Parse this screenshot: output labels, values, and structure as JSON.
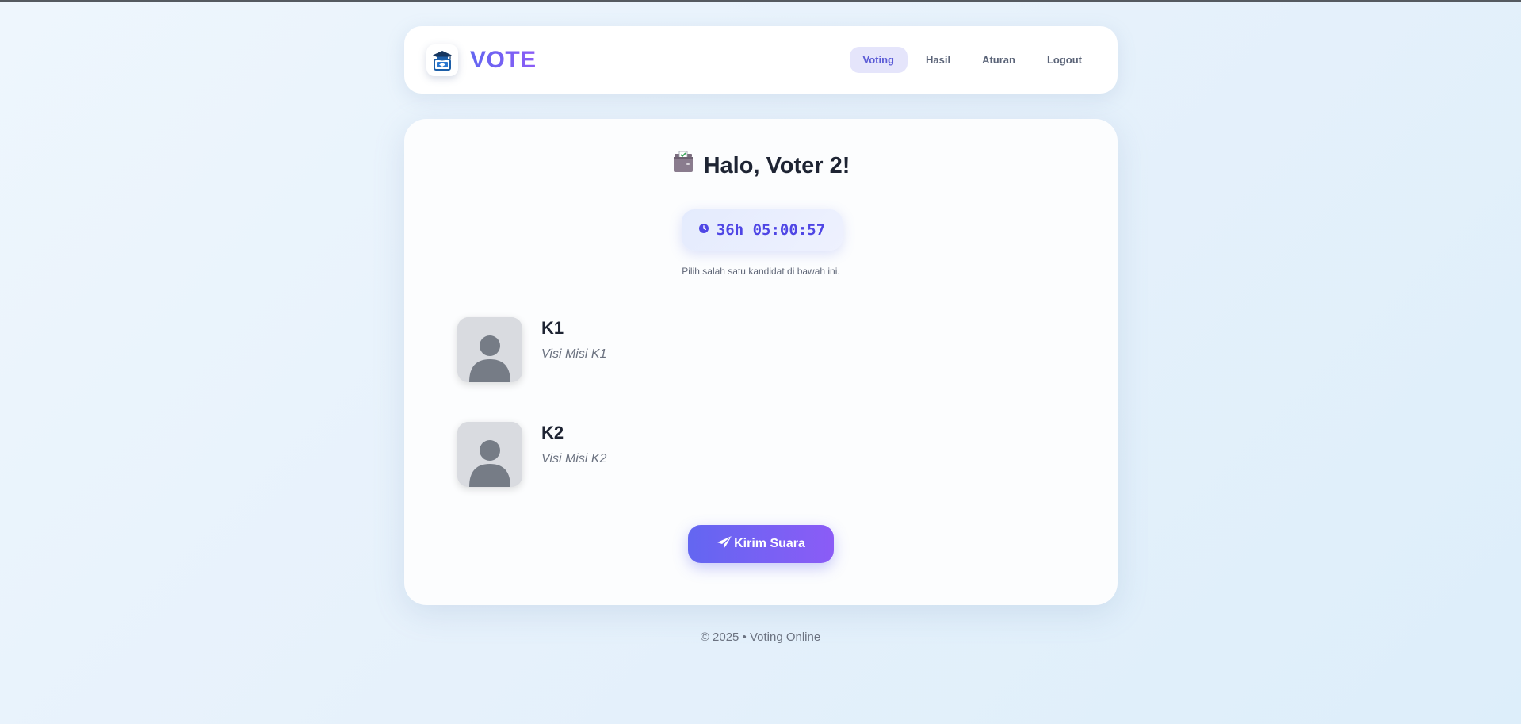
{
  "header": {
    "brand": "VOTE",
    "logo_icon": "graduation-ballot-icon",
    "nav": [
      {
        "label": "Voting",
        "active": true
      },
      {
        "label": "Hasil",
        "active": false
      },
      {
        "label": "Aturan",
        "active": false
      },
      {
        "label": "Logout",
        "active": false
      }
    ]
  },
  "main": {
    "title_icon": "ballot-box-icon",
    "title": "Halo, Voter 2!",
    "timer_icon": "clock-icon",
    "timer": "36h 05:00:57",
    "subtitle": "Pilih salah satu kandidat di bawah ini.",
    "candidates": [
      {
        "name": "K1",
        "description": "Visi Misi K1",
        "avatar_icon": "user-avatar-icon"
      },
      {
        "name": "K2",
        "description": "Visi Misi K2",
        "avatar_icon": "user-avatar-icon"
      }
    ],
    "submit_icon": "paper-plane-icon",
    "submit_label": "Kirim Suara"
  },
  "footer": {
    "text": "© 2025 • Voting Online"
  },
  "colors": {
    "accent": "#6366f1",
    "accent_end": "#8b5cf6",
    "text_dark": "#1e2433",
    "text_muted": "#6b7280"
  }
}
